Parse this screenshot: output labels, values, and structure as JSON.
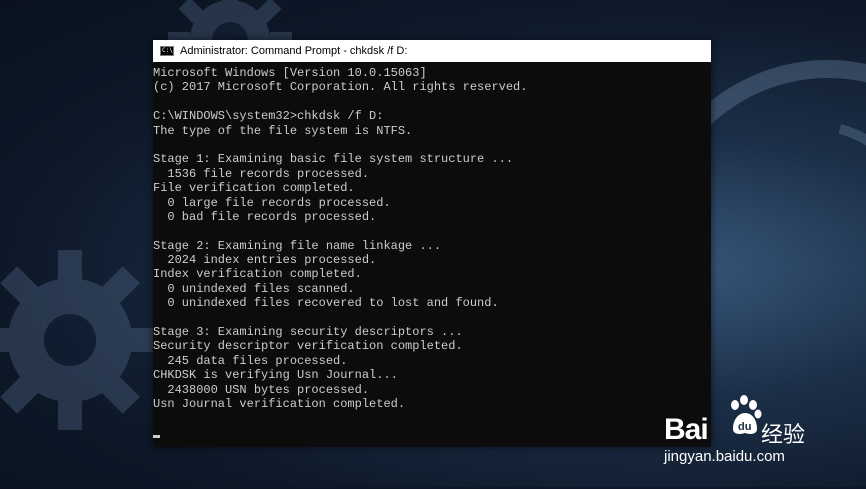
{
  "window": {
    "title": "Administrator: Command Prompt - chkdsk  /f D:",
    "icon_label": "C:\\"
  },
  "console": {
    "lines": [
      "Microsoft Windows [Version 10.0.15063]",
      "(c) 2017 Microsoft Corporation. All rights reserved.",
      "",
      "C:\\WINDOWS\\system32>chkdsk /f D:",
      "The type of the file system is NTFS.",
      "",
      "Stage 1: Examining basic file system structure ...",
      "  1536 file records processed.",
      "File verification completed.",
      "  0 large file records processed.",
      "  0 bad file records processed.",
      "",
      "Stage 2: Examining file name linkage ...",
      "  2024 index entries processed.",
      "Index verification completed.",
      "  0 unindexed files scanned.",
      "  0 unindexed files recovered to lost and found.",
      "",
      "Stage 3: Examining security descriptors ...",
      "Security descriptor verification completed.",
      "  245 data files processed.",
      "CHKDSK is verifying Usn Journal...",
      "  2438000 USN bytes processed.",
      "Usn Journal verification completed.",
      ""
    ]
  },
  "watermark": {
    "brand_left": "Bai",
    "brand_right": "经验",
    "url": "jingyan.baidu.com"
  },
  "colors": {
    "console_bg": "#0c0c0c",
    "console_text": "#cccccc",
    "titlebar_bg": "#ffffff"
  }
}
